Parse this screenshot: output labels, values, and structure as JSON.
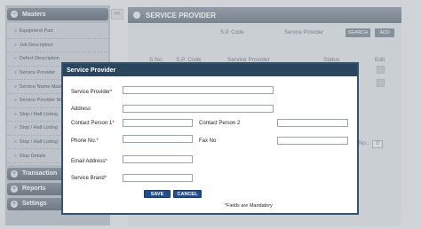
{
  "sidebar": {
    "masters": "Masters",
    "items": [
      "Equipment Part",
      "Job Description",
      "Defect Description",
      "Service Provider",
      "Service Name Master",
      "Service Provider Master",
      "Stop / Halt Listing",
      "Stop / Halt Listing",
      "Stop / Halt Listing",
      "Stop Details"
    ],
    "transaction": "Transaction",
    "reports": "Reports",
    "settings": "Settings",
    "collapse": "<<"
  },
  "main": {
    "title": "SERVICE PROVIDER",
    "search_code_label": "S.P. Code",
    "search_provider_label": "Service Provider",
    "search_button": "SEARCH",
    "add_button": "ADD",
    "columns": [
      "S.No.",
      "S.P. Code",
      "Service Provider",
      "Status",
      "Edit"
    ],
    "pager_label": "No.:",
    "pager_value": "0"
  },
  "modal": {
    "title": "Service Provider",
    "fields": {
      "service_provider": "Service Provider",
      "address": "Address",
      "contact1": "Contact Person 1",
      "contact2": "Contact Person 2",
      "phone": "Phone No.",
      "fax": "Fax No",
      "email": "Email Address",
      "brand": "Service Brand"
    },
    "values": {
      "service_provider": "",
      "address": "",
      "contact1": "",
      "contact2": "",
      "phone": "",
      "fax": "",
      "email": "",
      "brand": ""
    },
    "required_mark": "*",
    "save": "SAVE",
    "cancel": "CANCEL",
    "note": "Fields are Mandatory"
  },
  "colors": {
    "modal_header": "#29465e",
    "button": "#1f4f8c",
    "required": "#cc0000"
  }
}
